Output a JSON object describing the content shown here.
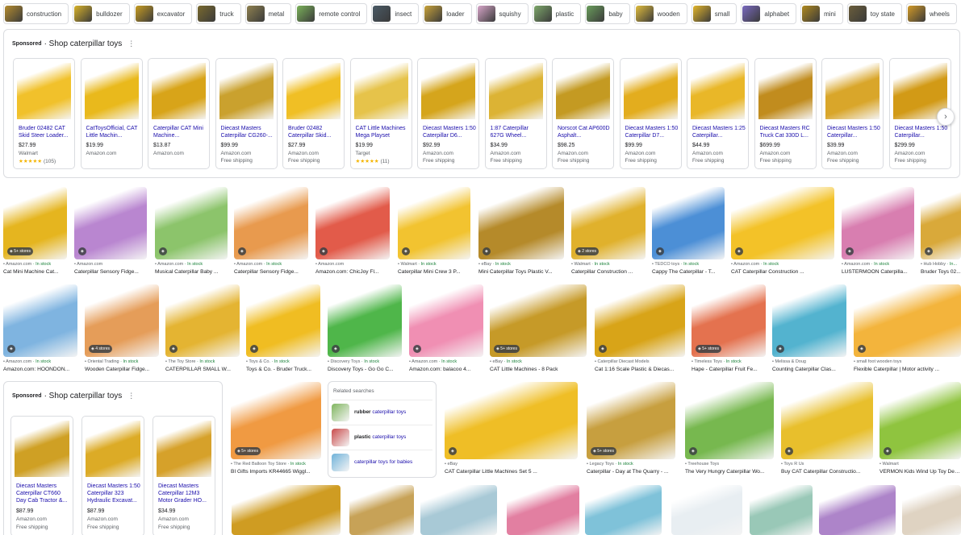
{
  "chips": [
    {
      "label": "construction",
      "color": "#b58d2f"
    },
    {
      "label": "bulldozer",
      "color": "#d8b32a"
    },
    {
      "label": "excavator",
      "color": "#c79d22"
    },
    {
      "label": "truck",
      "color": "#7a6a2e"
    },
    {
      "label": "metal",
      "color": "#8f8150"
    },
    {
      "label": "remote control",
      "color": "#7bb25a"
    },
    {
      "label": "insect",
      "color": "#4a5a66"
    },
    {
      "label": "loader",
      "color": "#c8a33a"
    },
    {
      "label": "squishy",
      "color": "#d7a6c9"
    },
    {
      "label": "plastic",
      "color": "#7ea86b"
    },
    {
      "label": "baby",
      "color": "#6a9e5c"
    },
    {
      "label": "wooden",
      "color": "#e0bc3c"
    },
    {
      "label": "small",
      "color": "#e2b52b"
    },
    {
      "label": "alphabet",
      "color": "#7a6ac0"
    },
    {
      "label": "mini",
      "color": "#b08a1f"
    },
    {
      "label": "toy state",
      "color": "#6b5e3b"
    },
    {
      "label": "wheels",
      "color": "#d39b27"
    },
    {
      "label": "",
      "color": "#9e8f6a"
    }
  ],
  "sponsored_top": {
    "sponsored": "Sponsored",
    "title": "· Shop caterpillar toys",
    "more": "⋮",
    "next": "›",
    "products": [
      {
        "name": "Bruder 02482 CAT Skid Steer Loader...",
        "price": "$27.99",
        "store": "Walmart",
        "ship": "",
        "stars": "★★★★★",
        "rating": "(105)",
        "color": "#f1c12b"
      },
      {
        "name": "CatToysOfficial, CAT Little Machin...",
        "price": "$19.99",
        "store": "Amazon.com",
        "ship": "",
        "stars": "",
        "rating": "",
        "color": "#e9b91c"
      },
      {
        "name": "Caterpillar CAT Mini Machine...",
        "price": "$13.87",
        "store": "Amazon.com",
        "ship": "",
        "stars": "",
        "rating": "",
        "color": "#d8a419"
      },
      {
        "name": "Diecast Masters Caterpillar CG260-...",
        "price": "$99.99",
        "store": "Amazon.com",
        "ship": "Free shipping",
        "stars": "",
        "rating": "",
        "color": "#caa12e"
      },
      {
        "name": "Bruder 02482 Caterpillar Skid...",
        "price": "$27.99",
        "store": "Amazon.com",
        "ship": "Free shipping",
        "stars": "",
        "rating": "",
        "color": "#f0bf25"
      },
      {
        "name": "CAT Little Machines Mega Playset",
        "price": "$19.99",
        "store": "Target",
        "ship": "",
        "stars": "★★★★★",
        "rating": "(11)",
        "color": "#e6c34a"
      },
      {
        "name": "Diecast Masters 1:50 Caterpillar D6...",
        "price": "$92.99",
        "store": "Amazon.com",
        "ship": "Free shipping",
        "stars": "",
        "rating": "",
        "color": "#d5a51c"
      },
      {
        "name": "1:87 Caterpillar 627G Wheel...",
        "price": "$34.99",
        "store": "Amazon.com",
        "ship": "Free shipping",
        "stars": "",
        "rating": "",
        "color": "#dcb334"
      },
      {
        "name": "Norscot Cat AP600D Asphalt...",
        "price": "$98.25",
        "store": "Amazon.com",
        "ship": "Free shipping",
        "stars": "",
        "rating": "",
        "color": "#c49a22"
      },
      {
        "name": "Diecast Masters 1:50 Caterpillar D7...",
        "price": "$99.99",
        "store": "Amazon.com",
        "ship": "Free shipping",
        "stars": "",
        "rating": "",
        "color": "#e3ad1e"
      },
      {
        "name": "Diecast Masters 1:25 Caterpillar...",
        "price": "$44.99",
        "store": "Amazon.com",
        "ship": "Free shipping",
        "stars": "",
        "rating": "",
        "color": "#e9b728"
      },
      {
        "name": "Diecast Masters RC Truck Cat 330D L...",
        "price": "$699.99",
        "store": "Amazon.com",
        "ship": "Free shipping",
        "stars": "",
        "rating": "",
        "color": "#c18c1e"
      },
      {
        "name": "Diecast Masters 1:50 Caterpillar...",
        "price": "$39.99",
        "store": "Amazon.com",
        "ship": "Free shipping",
        "stars": "",
        "rating": "",
        "color": "#d9a62a"
      },
      {
        "name": "Diecast Masters 1:50 Caterpillar...",
        "price": "$299.99",
        "store": "Amazon.com",
        "ship": "Free shipping",
        "stars": "",
        "rating": "",
        "color": "#d29a16"
      }
    ]
  },
  "sponsored_bottom": {
    "sponsored": "Sponsored",
    "title": "· Shop caterpillar toys",
    "more": "⋮",
    "products": [
      {
        "name": "Diecast Masters Caterpillar CT660 Day Cab Tractor &...",
        "price": "$87.99",
        "store": "Amazon.com",
        "ship": "Free shipping",
        "color": "#cfa024"
      },
      {
        "name": "Diecast Masters 1:50 Caterpillar 323 Hydraulic Excavat...",
        "price": "$87.99",
        "store": "Amazon.com",
        "ship": "Free shipping",
        "color": "#dcab26"
      },
      {
        "name": "Diecast Masters Caterpillar 12M3 Motor Grader HO...",
        "price": "$34.99",
        "store": "Amazon.com",
        "ship": "Free shipping",
        "color": "#d6a12a"
      }
    ]
  },
  "row1": [
    {
      "source": "Amazon.com",
      "stock": " · In stock",
      "caption": "Cat Mini Machine Cat...",
      "badge": "5+ stores",
      "color": "#e5b51f"
    },
    {
      "source": "Amazon.com",
      "stock": "",
      "caption": "Caterpillar Sensory Fidge...",
      "badge": "",
      "color": "#b986d0"
    },
    {
      "source": "Amazon.com",
      "stock": " · In stock",
      "caption": "Musical Caterpillar Baby ...",
      "badge": "",
      "color": "#8cc46b"
    },
    {
      "source": "Amazon.com",
      "stock": " · In stock",
      "caption": "Caterpillar Sensory Fidge...",
      "badge": "",
      "color": "#e89a4e"
    },
    {
      "source": "Amazon.com",
      "stock": "",
      "caption": "Amazon.com: ChicJoy Fl...",
      "badge": "",
      "color": "#e25b4a"
    },
    {
      "source": "Walmart",
      "stock": " · In stock",
      "caption": "Caterpillar Mini Crew 3 P...",
      "badge": "",
      "color": "#f2c330"
    },
    {
      "source": "eBay",
      "stock": " · In stock",
      "caption": "Mini Caterpillar Toys Plastic V...",
      "badge": "",
      "color": "#b58a2a"
    },
    {
      "source": "Walmart",
      "stock": " · In stock",
      "caption": "Caterpillar Construction ...",
      "badge": "2 stores",
      "color": "#e0b12c"
    },
    {
      "source": "TEDCO toys",
      "stock": " · In stock",
      "caption": "Cappy The Caterpillar - T...",
      "badge": "",
      "color": "#4c8fd6"
    },
    {
      "source": "Amazon.com",
      "stock": " · In stock",
      "caption": "CAT Caterpillar Construction ...",
      "badge": "",
      "color": "#f3c228"
    },
    {
      "source": "Amazon.com",
      "stock": " · In stock",
      "caption": "LUSTERMOON Caterpilla...",
      "badge": "",
      "color": "#d87eb0"
    },
    {
      "source": "Hub Hobby",
      "stock": " · In...",
      "caption": "Bruder Toys 02...",
      "badge": "",
      "color": "#d9a93a"
    }
  ],
  "row2": [
    {
      "source": "Amazon.com",
      "stock": " · In stock",
      "caption": "Amazon.com: HOONDON...",
      "badge": "",
      "color": "#7fb4e0"
    },
    {
      "source": "Oriental Trading",
      "stock": " · In stock",
      "caption": "Wooden Caterpillar Fidge...",
      "badge": "4 stores",
      "color": "#e59d59"
    },
    {
      "source": "The Toy Store",
      "stock": " · In stock",
      "caption": "CATERPILLAR SMALL W...",
      "badge": "",
      "color": "#e4b432"
    },
    {
      "source": "Toys & Co.",
      "stock": " · In stock",
      "caption": "Toys & Co. - Bruder Truck...",
      "badge": "",
      "color": "#f0bd22"
    },
    {
      "source": "Discovery Toys",
      "stock": " · In stock",
      "caption": "Discovery Toys - Go Go C...",
      "badge": "",
      "color": "#4fb64a"
    },
    {
      "source": "Amazon.com",
      "stock": " · In stock",
      "caption": "Amazon.com: balacoo 4...",
      "badge": "",
      "color": "#f08fb3"
    },
    {
      "source": "eBay",
      "stock": " · In stock",
      "caption": "CAT Little Machines - 8 Pack",
      "badge": "5+ stores",
      "color": "#c69a28"
    },
    {
      "source": "Caterpillar Diecast Models",
      "stock": "",
      "caption": "Cat 1:16 Scale Plastic & Diecas...",
      "badge": "",
      "color": "#d8a418"
    },
    {
      "source": "Timeless Toys",
      "stock": " · In stock",
      "caption": "Hape - Caterpillar Fruit Fe...",
      "badge": "5+ stores",
      "color": "#e4724f"
    },
    {
      "source": "Melissa & Doug",
      "stock": "",
      "caption": "Counting Caterpillar Clas...",
      "badge": "",
      "color": "#53b3cf"
    },
    {
      "source": "small foot wooden toys",
      "stock": "",
      "caption": "Flexible Caterpillar | Motor activity ...",
      "badge": "",
      "color": "#f3b43c"
    }
  ],
  "row3": [
    {
      "source": "The Red Balloon Toy Store",
      "stock": " · In stock",
      "caption": "BI Gifts Imports KR44665 Wiggl...",
      "badge": "5+ stores",
      "color": "#f09a42"
    },
    {
      "source": "eBay",
      "stock": "",
      "caption": "CAT Caterpillar Little Machines Set 5 ...",
      "badge": "",
      "color": "#efbe26"
    },
    {
      "source": "Legacy Toys",
      "stock": " · In stock",
      "caption": "Caterpillar - Day at The Quarry - ...",
      "badge": "5+ stores",
      "color": "#c79f3f"
    },
    {
      "source": "Treehouse Toys",
      "stock": "",
      "caption": "The Very Hungry Caterpillar Wo...",
      "badge": "",
      "color": "#77b84f"
    },
    {
      "source": "Toys R Us",
      "stock": "",
      "caption": "Buy CAT Caterpillar Constructio...",
      "badge": "",
      "color": "#e8bf2c"
    },
    {
      "source": "Walmart",
      "stock": "",
      "caption": "VERMON Kids Wind Up Toy Dec...",
      "badge": "",
      "color": "#8fc43f"
    }
  ],
  "row4": [
    {
      "color": "#cf9c22"
    },
    {
      "color": "#c7a257"
    },
    {
      "color": "#a8c9d6"
    },
    {
      "color": "#e27fa1"
    },
    {
      "color": "#7fc2d9"
    },
    {
      "color": "#e8eef2"
    },
    {
      "color": "#99c8b7"
    },
    {
      "color": "#ad84c9"
    },
    {
      "color": "#dfd3c2"
    }
  ],
  "related": {
    "heading": "Related searches",
    "items": [
      {
        "bold": "rubber",
        "rest": " caterpillar toys",
        "color": "#7fb55e"
      },
      {
        "bold": "plastic",
        "rest": " caterpillar toys",
        "color": "#c94b4b"
      },
      {
        "bold": "",
        "rest": "caterpillar toys for babies",
        "color": "#6fb2d9"
      }
    ]
  }
}
